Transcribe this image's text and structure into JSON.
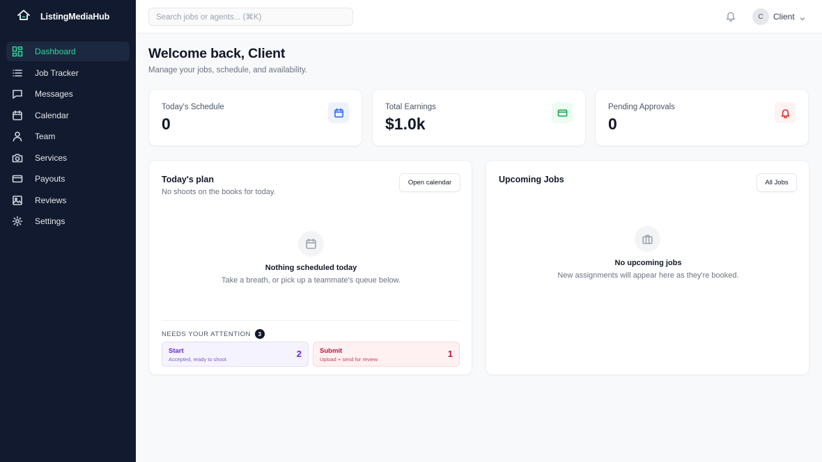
{
  "app": {
    "name": "ListingMediaHub",
    "colors": {
      "sidebar_bg": "#111a2e",
      "accent": "#34d399",
      "page_bg": "#f8f9fb"
    }
  },
  "sidebar": {
    "items": [
      {
        "label": "Dashboard",
        "icon": "dashboard-grid-icon",
        "active": true
      },
      {
        "label": "Job Tracker",
        "icon": "list-icon",
        "active": false
      },
      {
        "label": "Messages",
        "icon": "message-icon",
        "active": false
      },
      {
        "label": "Calendar",
        "icon": "calendar-icon",
        "active": false
      },
      {
        "label": "Team",
        "icon": "user-icon",
        "active": false
      },
      {
        "label": "Services",
        "icon": "camera-icon",
        "active": false
      },
      {
        "label": "Payouts",
        "icon": "credit-card-icon",
        "active": false
      },
      {
        "label": "Reviews",
        "icon": "image-icon",
        "active": false
      },
      {
        "label": "Settings",
        "icon": "gear-icon",
        "active": false
      }
    ]
  },
  "topbar": {
    "search_placeholder": "Search jobs or agents...  (⌘K)",
    "user_initial": "C",
    "user_name": "Client"
  },
  "header": {
    "title": "Welcome back, Client",
    "subtitle": "Manage your jobs, schedule, and availability."
  },
  "stats": [
    {
      "label": "Today's Schedule",
      "value": "0",
      "icon": "calendar-icon",
      "color": "#2563eb",
      "bg": "#eef2ff"
    },
    {
      "label": "Total Earnings",
      "value": "$1.0k",
      "icon": "credit-card-icon",
      "color": "#16a34a",
      "bg": "#ecfdf3"
    },
    {
      "label": "Pending Approvals",
      "value": "0",
      "icon": "bell-icon",
      "color": "#dc2626",
      "bg": "#fef2f2"
    }
  ],
  "plan": {
    "title": "Today's plan",
    "subtitle": "No shoots on the books for today.",
    "button": "Open calendar",
    "empty_title": "Nothing scheduled today",
    "empty_subtitle": "Take a breath, or pick up a teammate's queue below.",
    "attention_label": "NEEDS YOUR ATTENTION",
    "attention_count": "3",
    "queues": [
      {
        "title": "Start",
        "subtitle": "Accepted, ready to shoot",
        "count": "2",
        "color": "#6d28d9",
        "bg": "#f5f3ff",
        "border": "#e4dcfb"
      },
      {
        "title": "Submit",
        "subtitle": "Upload + send for review",
        "count": "1",
        "color": "#be123c",
        "bg": "#fff1f2",
        "border": "#fbd5db"
      }
    ]
  },
  "upcoming": {
    "title": "Upcoming Jobs",
    "button": "All Jobs",
    "empty_title": "No upcoming jobs",
    "empty_subtitle": "New assignments will appear here as they're booked."
  }
}
